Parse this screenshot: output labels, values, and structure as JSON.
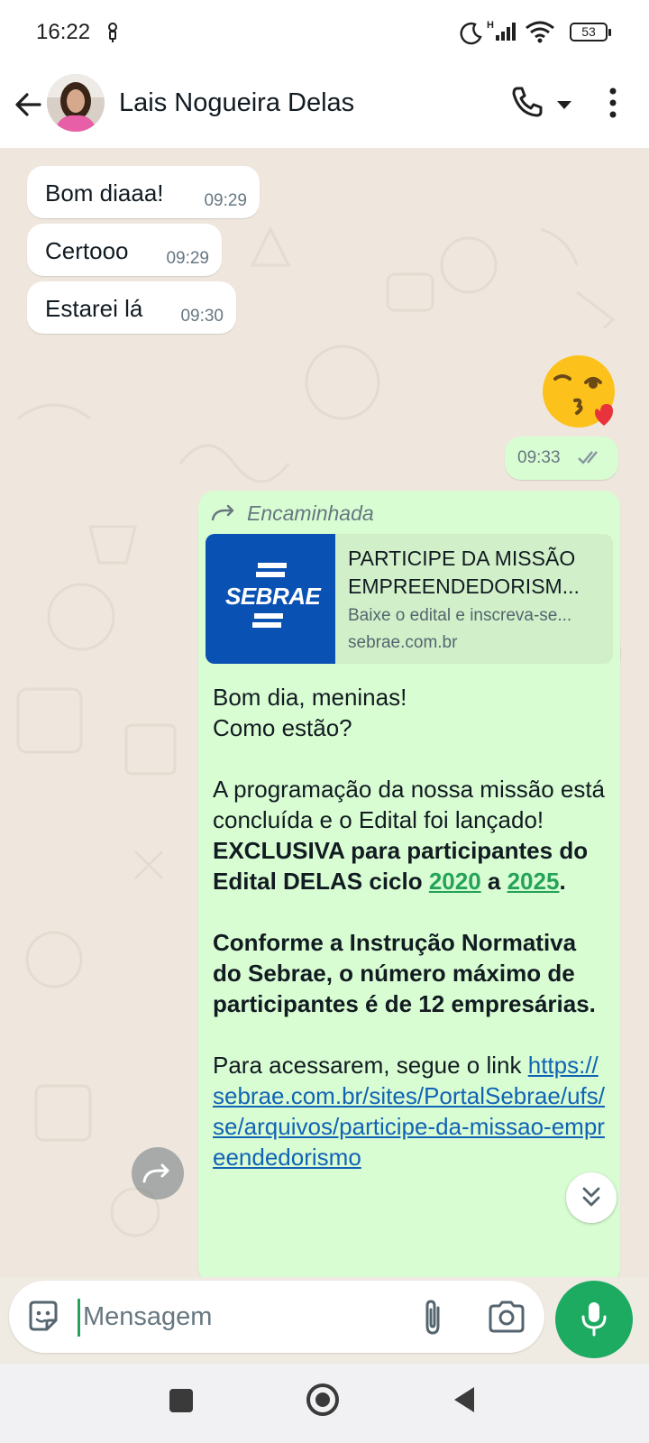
{
  "status_bar": {
    "time": "16:22",
    "battery": "53"
  },
  "header": {
    "contact_name": "Lais Nogueira Delas"
  },
  "messages_in": [
    {
      "text": "Bom diaaa!",
      "time": "09:29"
    },
    {
      "text": "Certooo",
      "time": "09:29"
    },
    {
      "text": "Estarei lá",
      "time": "09:30"
    }
  ],
  "message_out": {
    "emoji": "kiss-heart",
    "time": "09:33"
  },
  "forwarded": {
    "label": "Encaminhada",
    "link_preview": {
      "logo_text": "SEBRAE",
      "title": "PARTICIPE DA MISSÃO EMPREENDEDORISM...",
      "description": "Baixe o edital e inscreva-se...",
      "domain": "sebrae.com.br"
    },
    "greeting_line1": "Bom dia, meninas!",
    "greeting_line2": "Como estão?",
    "p2_text": "A programação da nossa missão está concluída e o Edital foi lançado! ",
    "p2_bold1": "EXCLUSIVA para participantes do Edital DELAS ciclo ",
    "p2_year1": "2020",
    "p2_bold_mid": " a ",
    "p2_year2": "2025",
    "p2_bold_end": ".",
    "p3_bold": "Conforme a Instrução Normativa do Sebrae, o número máximo de participantes é de 12 empresárias.",
    "p4_text": "Para acessarem, segue o link ",
    "p4_link": "https://sebrae.com.br/sites/PortalSebrae/ufs/se/arquivos/participe-da-missao-empreendedorismo"
  },
  "composer": {
    "placeholder": "Mensagem"
  }
}
